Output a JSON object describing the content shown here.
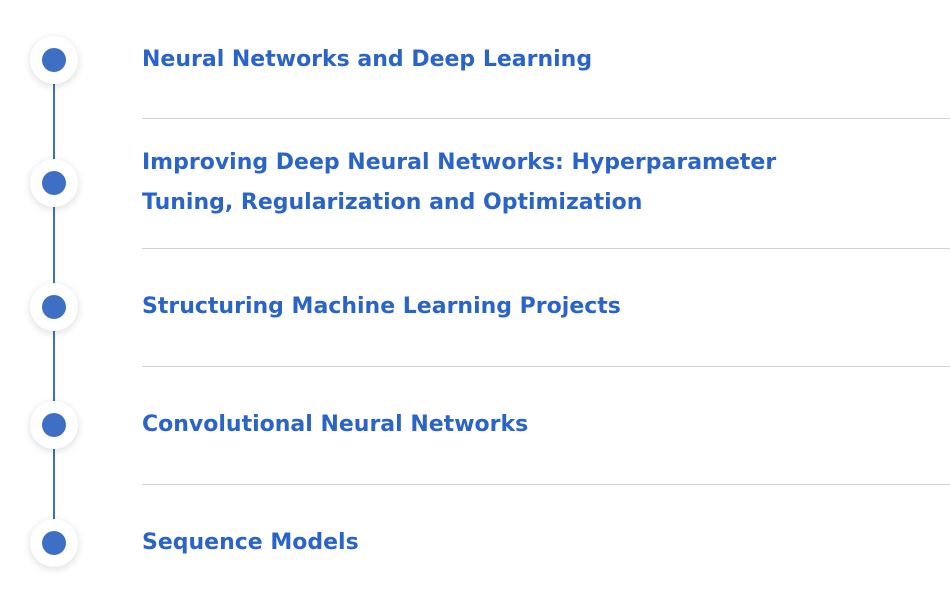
{
  "courses": [
    {
      "title": "Neural Networks and Deep Learning"
    },
    {
      "title": "Improving Deep Neural Networks: Hyperparameter Tuning, Regularization and Optimization"
    },
    {
      "title": "Structuring Machine Learning Projects"
    },
    {
      "title": "Convolutional Neural Networks"
    },
    {
      "title": "Sequence Models"
    }
  ],
  "colors": {
    "accent": "#3d6fc4",
    "link": "#2a64c8",
    "divider": "#d3d3d3"
  }
}
